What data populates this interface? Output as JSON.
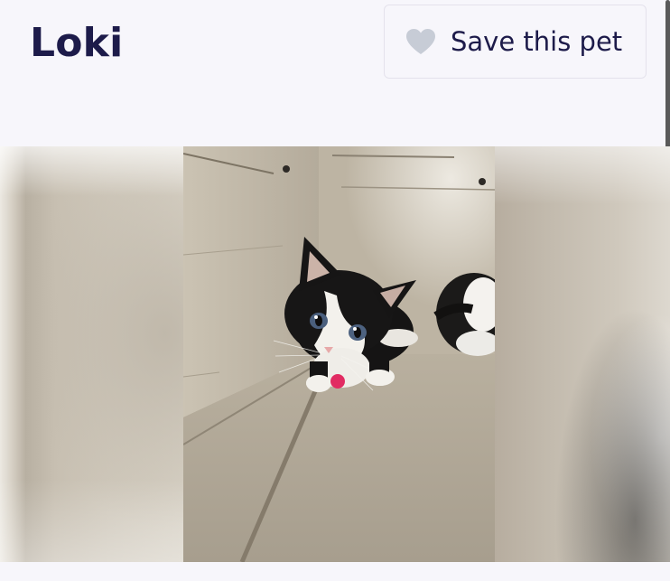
{
  "pet": {
    "name": "Loki"
  },
  "save": {
    "label": "Save this pet",
    "icon": "heart-icon",
    "icon_color": "#c7ccd6"
  },
  "carousel": {
    "current_index": 1,
    "slides_visible": 3,
    "active_dot_color": "#e12b62",
    "photo_alt": "black and white kitten in a tan kennel"
  },
  "colors": {
    "background": "#f7f6fb",
    "text": "#1d1b4a",
    "accent": "#e12b62"
  }
}
